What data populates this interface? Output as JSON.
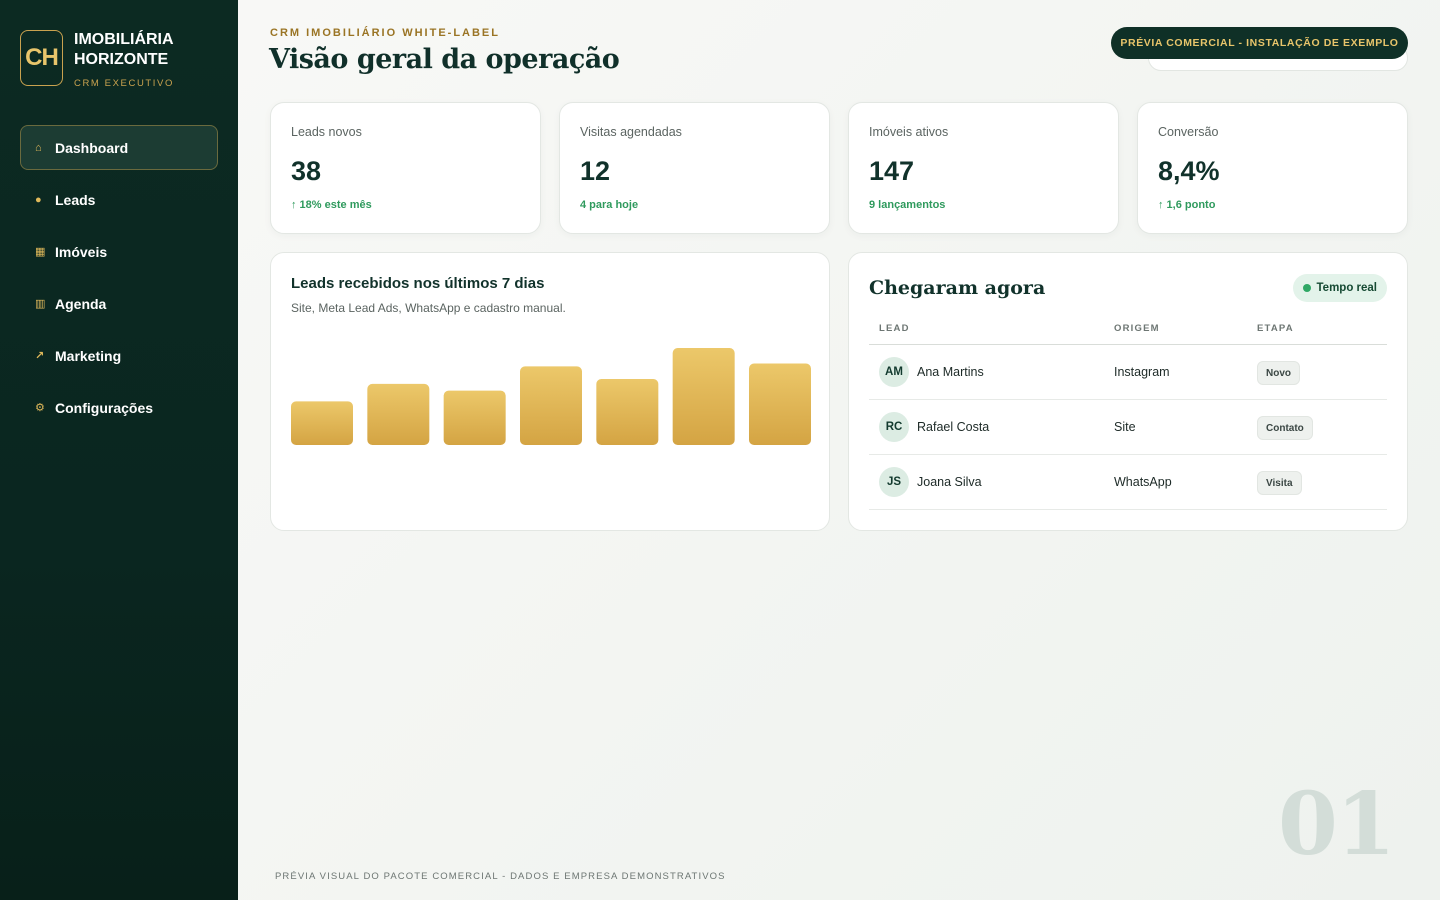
{
  "sidebar": {
    "logo_initials": "CH",
    "brand_name": "IMOBILIÁRIA HORIZONTE",
    "brand_sub": "CRM EXECUTIVO",
    "items": [
      {
        "label": "Dashboard",
        "icon": "home-icon",
        "glyph": "⌂",
        "active": true
      },
      {
        "label": "Leads",
        "icon": "user-circle-icon",
        "glyph": "●",
        "active": false
      },
      {
        "label": "Imóveis",
        "icon": "building-icon",
        "glyph": "▦",
        "active": false
      },
      {
        "label": "Agenda",
        "icon": "calendar-icon",
        "glyph": "▥",
        "active": false
      },
      {
        "label": "Marketing",
        "icon": "trend-arrow-icon",
        "glyph": "↗",
        "active": false
      },
      {
        "label": "Configurações",
        "icon": "gear-icon",
        "glyph": "⚙",
        "active": false
      }
    ]
  },
  "header": {
    "eyebrow": "CRM IMOBILIÁRIO WHITE-LABEL",
    "title": "Visão geral da operação",
    "preview_badge": "PRÉVIA COMERCIAL - INSTALAÇÃO DE EXEMPLO"
  },
  "stats": [
    {
      "label": "Leads novos",
      "value": "38",
      "delta": "↑ 18% este mês"
    },
    {
      "label": "Visitas agendadas",
      "value": "12",
      "delta": "4 para hoje"
    },
    {
      "label": "Imóveis ativos",
      "value": "147",
      "delta": "9 lançamentos"
    },
    {
      "label": "Conversão",
      "value": "8,4%",
      "delta": "↑ 1,6 ponto"
    }
  ],
  "chart": {
    "title": "Leads recebidos nos últimos 7 dias",
    "subtitle": "Site, Meta Lead Ads, WhatsApp e cadastro manual."
  },
  "chart_data": {
    "type": "bar",
    "categories": [
      "",
      "",
      "",
      "",
      "",
      "",
      ""
    ],
    "values": [
      45,
      63,
      56,
      81,
      68,
      100,
      84
    ],
    "ylim": [
      0,
      100
    ],
    "grid": false,
    "colors": {
      "bar_top": "#ecc86a",
      "bar_bottom": "#d4a443"
    }
  },
  "recent": {
    "title": "Chegaram agora",
    "live_label": "Tempo real",
    "columns": [
      "LEAD",
      "ORIGEM",
      "ETAPA"
    ],
    "rows": [
      {
        "initials": "AM",
        "name": "Ana Martins",
        "origin": "Instagram",
        "stage": "Novo"
      },
      {
        "initials": "RC",
        "name": "Rafael Costa",
        "origin": "Site",
        "stage": "Contato"
      },
      {
        "initials": "JS",
        "name": "Joana Silva",
        "origin": "WhatsApp",
        "stage": "Visita"
      }
    ]
  },
  "footer": {
    "note": "PRÉVIA VISUAL DO PACOTE COMERCIAL - DADOS E EMPRESA DEMONSTRATIVOS",
    "page_number": "01"
  },
  "colors": {
    "sidebar_bg": "#0c2a22",
    "accent_gold": "#c9a24f",
    "positive_green": "#2f9a5d",
    "title_green": "#10302a"
  }
}
